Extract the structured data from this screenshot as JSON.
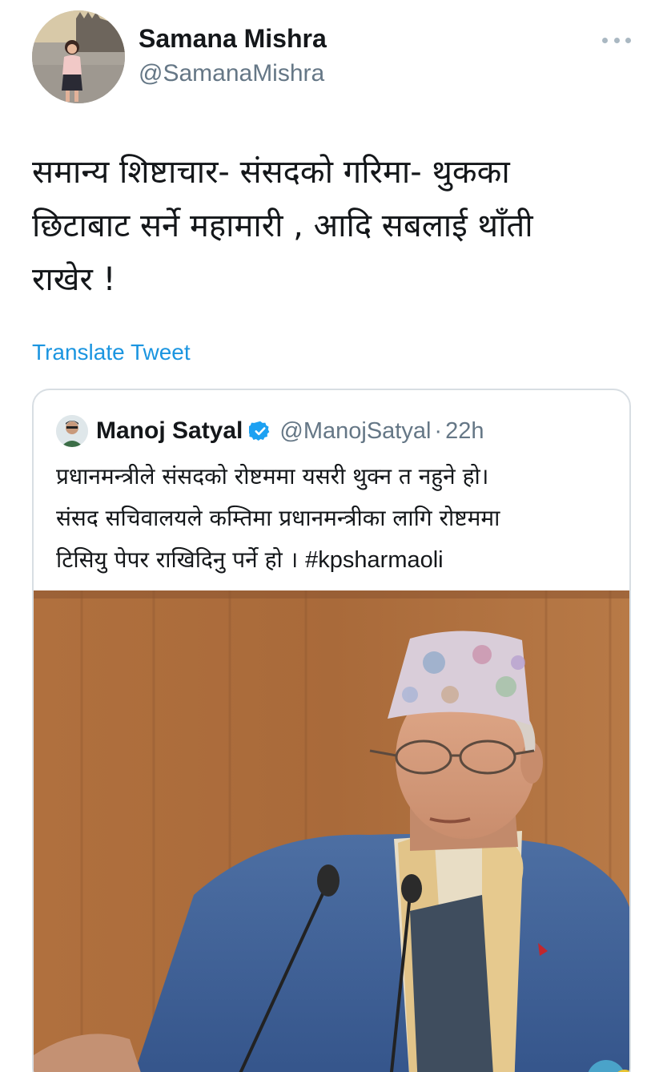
{
  "tweet": {
    "author_name": "Samana Mishra",
    "author_handle": "@SamanaMishra",
    "text_lines": [
      "समान्य शिष्टाचार- संसदको गरिमा- थुकका",
      "छिटाबाट सर्ने महामारी , आदि सबलाई थाँती",
      "राखेर !"
    ],
    "translate_label": "Translate Tweet"
  },
  "quoted_tweet": {
    "author_name": "Manoj Satyal",
    "author_handle": "@ManojSatyal",
    "separator": "·",
    "time": "22h",
    "text_lines": [
      "प्रधानमन्त्रीले संसदको रोष्टममा यसरी थुक्न त नहुने हो।",
      "संसद सचिवालयले कम्तिमा प्रधानमन्त्रीका लागि रोष्टममा"
    ],
    "last_line_text": "टिसियु पेपर राखिदिनु पर्ने हो ।",
    "hashtag": "#kpsharmaoli"
  },
  "icons": {
    "more": "more-horizontal-icon",
    "verified": "verified-badge-icon"
  },
  "colors": {
    "link": "#1b95e0",
    "secondary_text": "#657786",
    "verified": "#1da1f2",
    "card_border": "#d8dee3"
  }
}
